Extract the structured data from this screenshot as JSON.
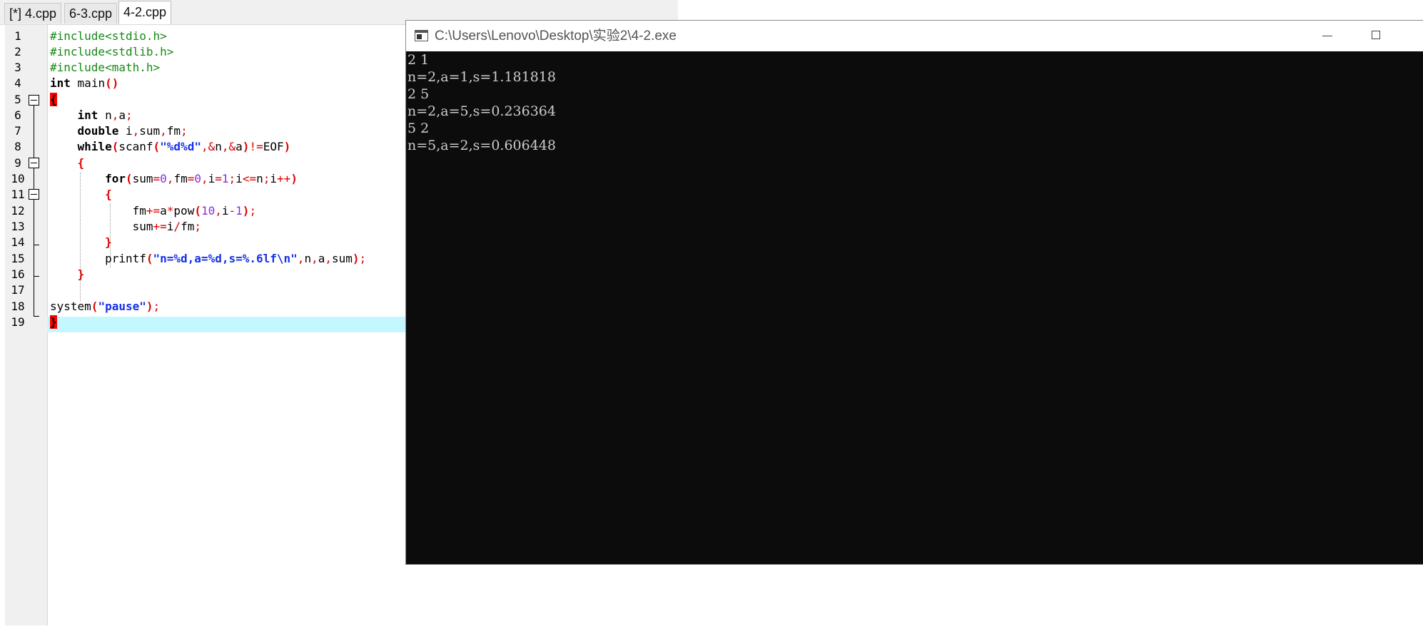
{
  "tabs": [
    {
      "label": "[*] 4.cpp",
      "active": false
    },
    {
      "label": "6-3.cpp",
      "active": false
    },
    {
      "label": "4-2.cpp",
      "active": true
    }
  ],
  "editor": {
    "line_numbers": [
      "1",
      "2",
      "3",
      "4",
      "5",
      "6",
      "7",
      "8",
      "9",
      "10",
      "11",
      "12",
      "13",
      "14",
      "15",
      "16",
      "17",
      "18",
      "19"
    ],
    "current_line": 19,
    "lines": [
      "#include<stdio.h>",
      "#include<stdlib.h>",
      "#include<math.h>",
      "int main()",
      "{",
      "    int n,a;",
      "    double i,sum,fm;",
      "    while(scanf(\"%d%d\",&n,&a)!=EOF)",
      "    {",
      "        for(sum=0,fm=0,i=1;i<=n;i++)",
      "        {",
      "            fm+=a*pow(10,i-1);",
      "            sum+=i/fm;",
      "        }",
      "        printf(\"n=%d,a=%d,s=%.6lf\\n\",n,a,sum);",
      "    }",
      "",
      "system(\"pause\");",
      "}"
    ],
    "colors": {
      "preprocessor": "#148a14",
      "keyword": "#000000",
      "bracket": "#e00000",
      "number": "#8a2be2",
      "string": "#1530e8",
      "current_line_bg": "#c4f8ff",
      "matched_brace_bg": "#ff0000"
    }
  },
  "console": {
    "title": "C:\\Users\\Lenovo\\Desktop\\实验2\\4-2.exe",
    "icon": "console-app-icon",
    "controls": {
      "minimize_icon": "minimize-icon",
      "maximize_icon": "maximize-icon",
      "close_icon": "close-icon"
    },
    "output_lines": [
      "2 1",
      "n=2,a=1,s=1.181818",
      "2 5",
      "n=2,a=5,s=0.236364",
      "5 2",
      "n=5,a=2,s=0.606448"
    ],
    "colors": {
      "background": "#0c0c0c",
      "text": "#cccccc"
    }
  }
}
